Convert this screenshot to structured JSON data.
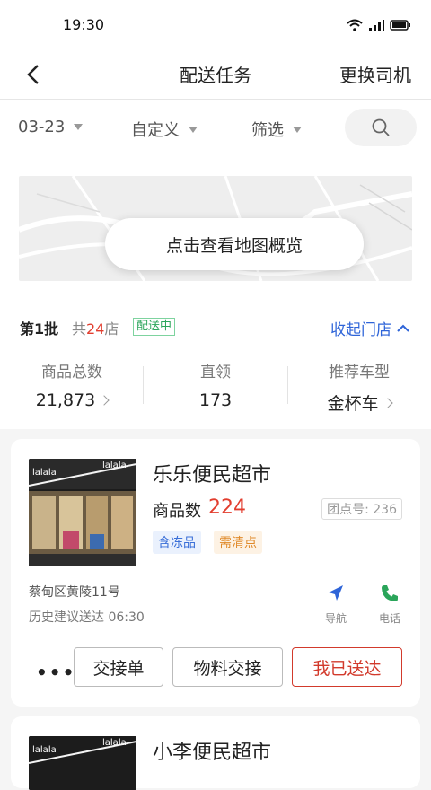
{
  "status_bar": {
    "time": "19:30"
  },
  "header": {
    "title": "配送任务",
    "right_action": "更换司机"
  },
  "filters": {
    "date": "03-23",
    "custom": "自定义",
    "filter": "筛选"
  },
  "map": {
    "overview_button": "点击查看地图概览"
  },
  "batch": {
    "label": "第1批",
    "count_prefix": "共",
    "count": "24",
    "count_suffix": "店",
    "status": "配送中",
    "collapse_label": "收起门店",
    "stats": [
      {
        "label": "商品总数",
        "value": "21,873"
      },
      {
        "label": "直领",
        "value": "173"
      },
      {
        "label": "推荐车型",
        "value": "金杯车"
      }
    ]
  },
  "stores": [
    {
      "name": "乐乐便民超市",
      "goods_label": "商品数",
      "goods_count": "224",
      "group_no": "团点号: 236",
      "tags": [
        "含冻品",
        "需清点"
      ],
      "address": "蔡甸区黄陵11号",
      "suggest_time": "历史建议送达 06:30",
      "nav_label": "导航",
      "phone_label": "电话",
      "sign_text": "lalala",
      "more_label": "•••",
      "buttons": {
        "handover": "交接单",
        "material": "物料交接",
        "delivered": "我已送达"
      }
    },
    {
      "name": "小李便民超市",
      "sign_text": "lalala"
    }
  ],
  "colors": {
    "accent_blue": "#2e64d8",
    "accent_red": "#d23a2c",
    "status_green": "#2aa55a"
  }
}
